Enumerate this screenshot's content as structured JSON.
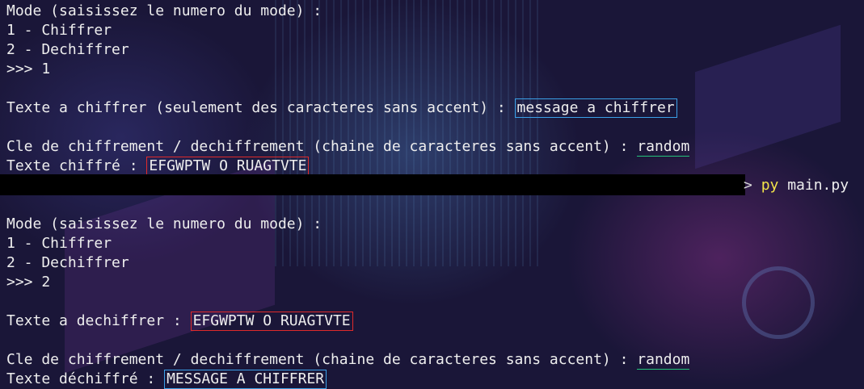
{
  "session1": {
    "mode_prompt": "Mode (saisissez le numero du mode) :",
    "option1": "1 - Chiffrer",
    "option2": "2 - Dechiffrer",
    "mode_input": ">>> 1",
    "text_prompt": "Texte a chiffrer (seulement des caracteres sans accent) : ",
    "text_value": "message a chiffrer",
    "key_prompt": "Cle de chiffrement / dechiffrement (chaine de caracteres sans accent) : ",
    "key_value": "random",
    "result_label": "Texte chiffré : ",
    "result_value": "EFGWPTW O RUAGTVTE"
  },
  "shell": {
    "prompt_symbol": "> ",
    "command": "py",
    "argument": " main.py"
  },
  "session2": {
    "mode_prompt": "Mode (saisissez le numero du mode) :",
    "option1": "1 - Chiffrer",
    "option2": "2 - Dechiffrer",
    "mode_input": ">>> 2",
    "text_prompt": "Texte a dechiffrer : ",
    "text_value": "EFGWPTW O RUAGTVTE",
    "key_prompt": "Cle de chiffrement / dechiffrement (chaine de caracteres sans accent) : ",
    "key_value": "random",
    "result_label": "Texte déchiffré : ",
    "result_value": "MESSAGE A CHIFFRER"
  },
  "colors": {
    "background": "#1a1638",
    "text": "#eeeeee",
    "highlight_blue": "#3aa0e8",
    "highlight_red": "#e02a2a",
    "underline_green": "#23c27a",
    "command_yellow": "#f2e34a"
  }
}
